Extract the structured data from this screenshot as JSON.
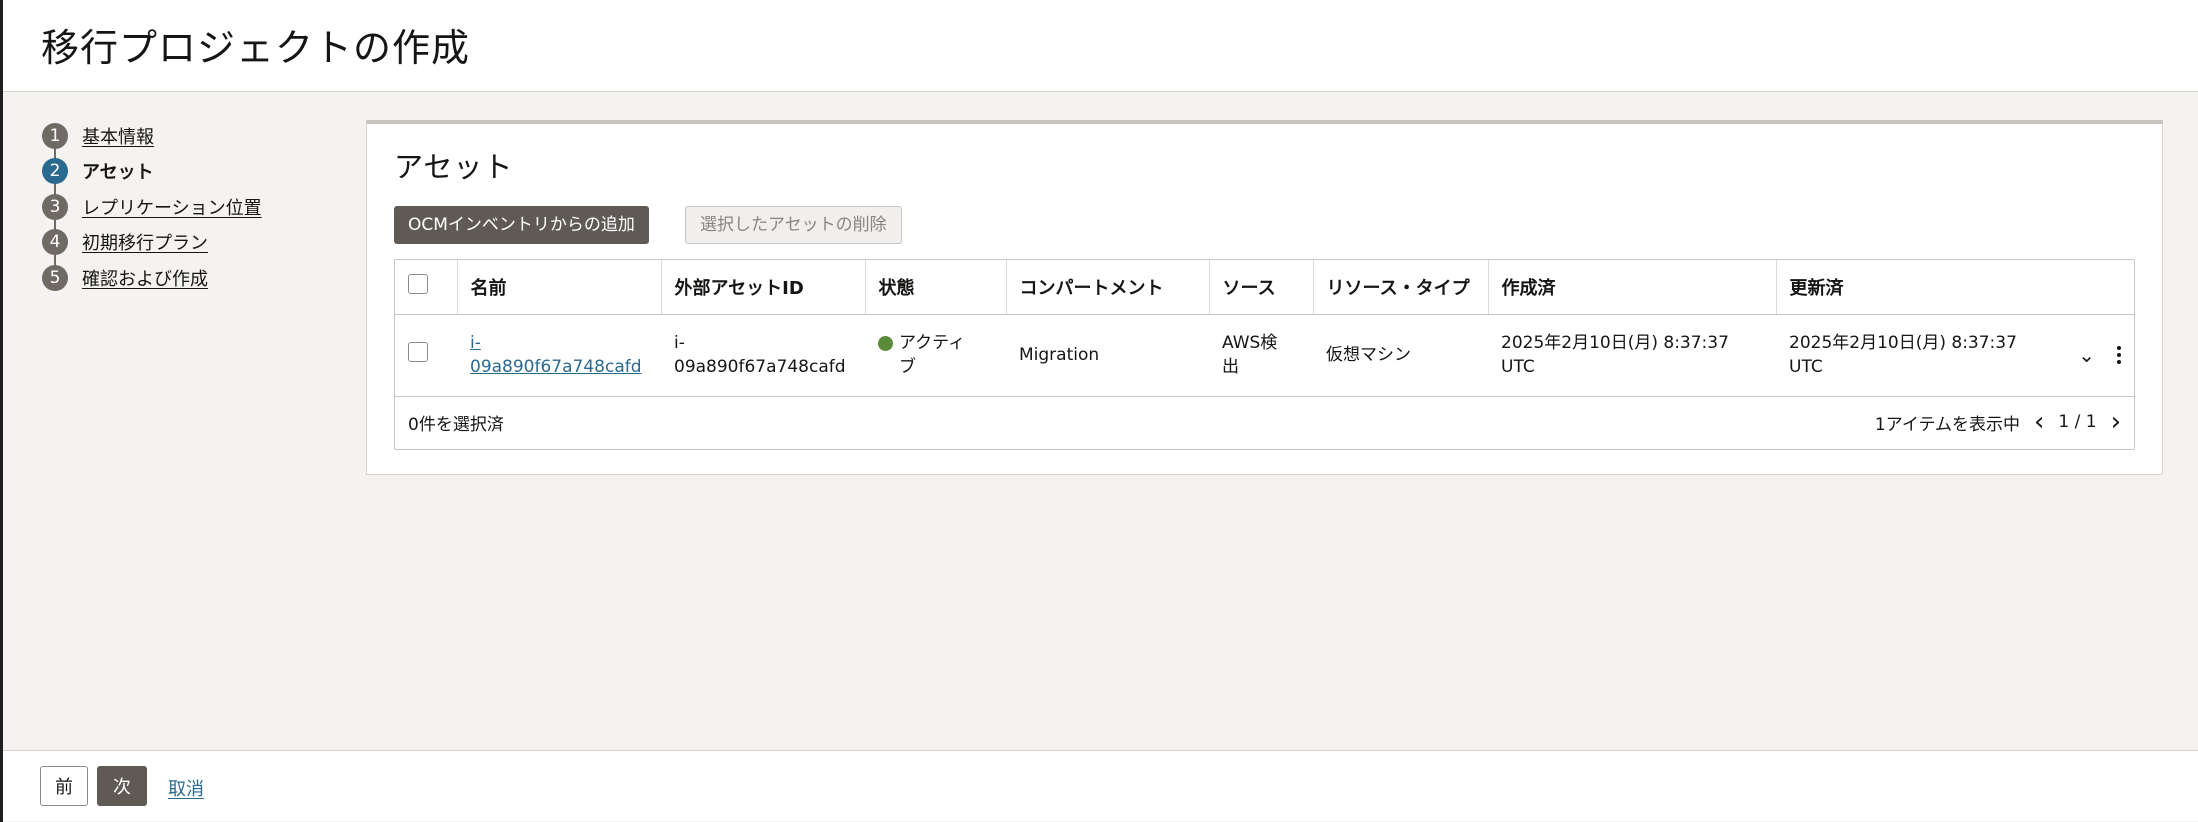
{
  "page": {
    "title": "移行プロジェクトの作成"
  },
  "steps": [
    {
      "num": "1",
      "label": "基本情報",
      "state": "done"
    },
    {
      "num": "2",
      "label": "アセット",
      "state": "current"
    },
    {
      "num": "3",
      "label": "レプリケーション位置",
      "state": "todo"
    },
    {
      "num": "4",
      "label": "初期移行プラン",
      "state": "todo"
    },
    {
      "num": "5",
      "label": "確認および作成",
      "state": "todo"
    }
  ],
  "panel": {
    "title": "アセット",
    "add_button": "OCMインベントリからの追加",
    "delete_button": "選択したアセットの削除"
  },
  "table": {
    "columns": [
      "名前",
      "外部アセットID",
      "状態",
      "コンパートメント",
      "ソース",
      "リソース・タイプ",
      "作成済",
      "更新済"
    ],
    "rows": [
      {
        "name": "i-\n09a890f67a748cafd",
        "external_id": "i-\n09a890f67a748cafd",
        "status": "アクティ\nブ",
        "compartment": "Migration",
        "source": "AWS検\n出",
        "resource_type": "仮想マシン",
        "created": "2025年2月10日(月) 8:37:37\nUTC",
        "updated": "2025年2月10日(月) 8:37:37\nUTC"
      }
    ],
    "selected_count": "0件を選択済",
    "items_shown": "1アイテムを表示中",
    "page_info": "1 / 1"
  },
  "footer": {
    "prev": "前",
    "next": "次",
    "cancel": "取消"
  },
  "colors": {
    "primary_button": "#605a55",
    "link": "#2b6a90",
    "status_active": "#5a8b3a",
    "current_step": "#2b6a90"
  },
  "icons": [
    "checkbox-icon",
    "status-dot-icon",
    "chevron-down-icon",
    "kebab-menu-icon",
    "chevron-left-icon",
    "chevron-right-icon"
  ]
}
